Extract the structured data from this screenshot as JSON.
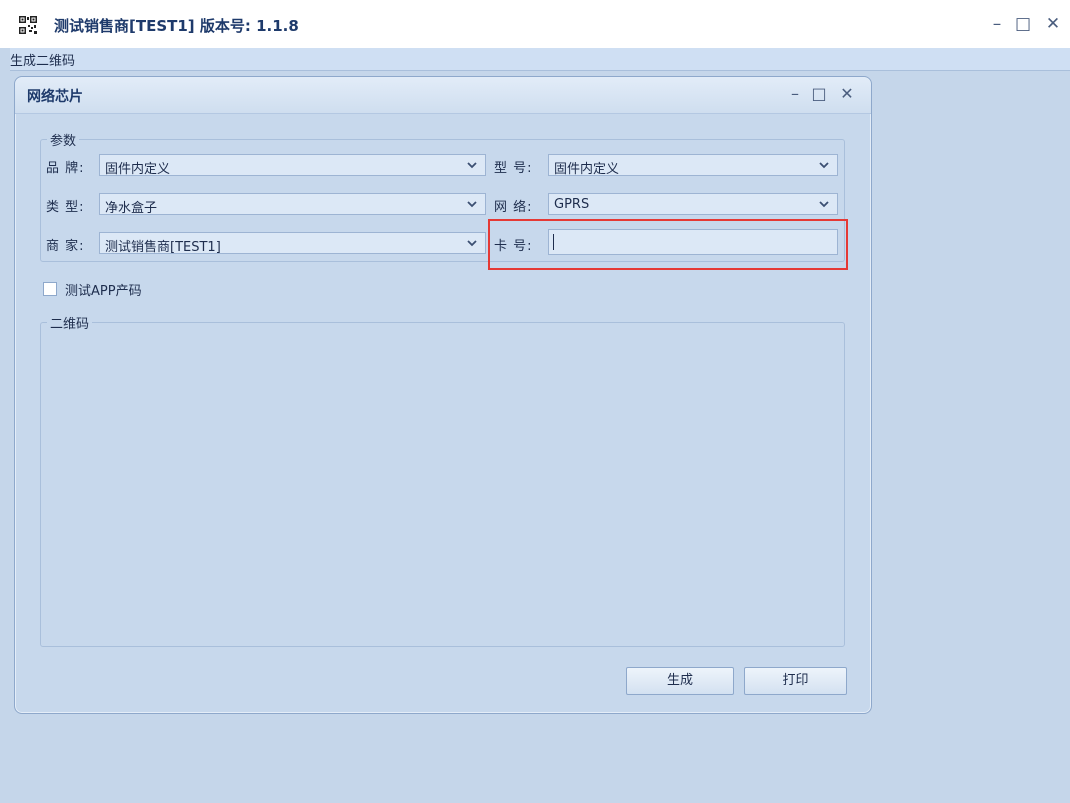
{
  "window": {
    "title": "测试销售商[TEST1] 版本号: 1.1.8",
    "minimize": "–",
    "maximize": "□",
    "close": "✕"
  },
  "menu": {
    "items": [
      {
        "label": "生成二维码"
      }
    ]
  },
  "child_window": {
    "title": "网络芯片",
    "minimize": "–",
    "maximize": "□",
    "close": "✕"
  },
  "params": {
    "group_label": "参数",
    "brand": {
      "label": "品 牌:",
      "value": "固件内定义"
    },
    "model": {
      "label": "型 号:",
      "value": "固件内定义"
    },
    "type": {
      "label": "类 型:",
      "value": "净水盒子"
    },
    "network": {
      "label": "网 络:",
      "value": "GPRS"
    },
    "merchant": {
      "label": "商 家:",
      "value": "测试销售商[TEST1]"
    },
    "card": {
      "label": "卡 号:",
      "value": ""
    }
  },
  "test_app_checkbox": {
    "label": "测试APP产码",
    "checked": false
  },
  "qr_group": {
    "label": "二维码"
  },
  "buttons": {
    "generate": "生成",
    "print": "打印"
  },
  "colors": {
    "highlight": "#e53935",
    "background": "#c5d6ea"
  }
}
